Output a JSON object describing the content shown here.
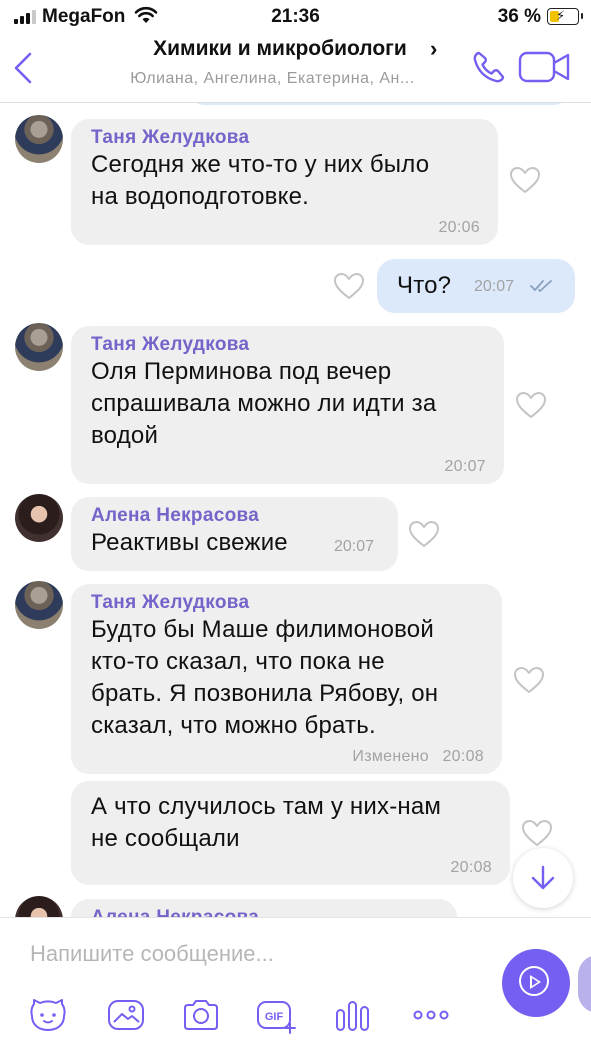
{
  "status_bar": {
    "carrier": "MegaFon",
    "time": "21:36",
    "battery_percent": "36 %",
    "battery_level": 0.36,
    "battery_charging": true,
    "signal_bars": 3
  },
  "header": {
    "title": "Химики и микробиологи",
    "title_chevron": "›",
    "subtitle": "Юлиана, Ангелина, Екатерина, Ан...",
    "icons": [
      "back-chevron-icon",
      "phone-icon",
      "video-camera-icon"
    ],
    "accent_color": "#7360f2"
  },
  "messages": [
    {
      "sender": "Таня Желудкова",
      "avatar": "tanya",
      "lines": [
        "Сегодня же что-то у них было",
        "на водоподготовке."
      ],
      "time": "20:06"
    },
    {
      "outgoing": true,
      "text": "Что?",
      "time": "20:07",
      "status": "read"
    },
    {
      "sender": "Таня Желудкова",
      "avatar": "tanya",
      "lines": [
        "Оля Перминова под вечер",
        "спрашивала можно ли идти за",
        "водой"
      ],
      "time": "20:07"
    },
    {
      "sender": "Алена Некрасова",
      "avatar": "alena",
      "text": "Реактивы свежие",
      "time": "20:07"
    },
    {
      "sender": "Таня Желудкова",
      "avatar": "tanya",
      "lines": [
        "Будто бы Маше филимоновой",
        "кто-то сказал, что пока не",
        "брать. Я позвонила Рябову, он",
        "сказал, что можно брать."
      ],
      "edited_label": "Изменено",
      "time": "20:08"
    },
    {
      "sender": "",
      "lines": [
        "А что случилось там у них-нам",
        "не сообщали"
      ],
      "time": "20:08"
    },
    {
      "sender": "Алена Некрасова",
      "avatar": "alena",
      "partial": true
    }
  ],
  "composer": {
    "placeholder": "Напишите сообщение...",
    "toolbar": [
      "sticker-icon",
      "gallery-icon",
      "camera-icon",
      "gif-icon",
      "poll-icon",
      "more-icon"
    ],
    "gif_label": "GIF"
  },
  "colors": {
    "incoming_bubble": "#efefef",
    "outgoing_bubble": "#dbe9fb",
    "sender_name": "#7564c9",
    "timestamp": "#a3a3a3"
  }
}
